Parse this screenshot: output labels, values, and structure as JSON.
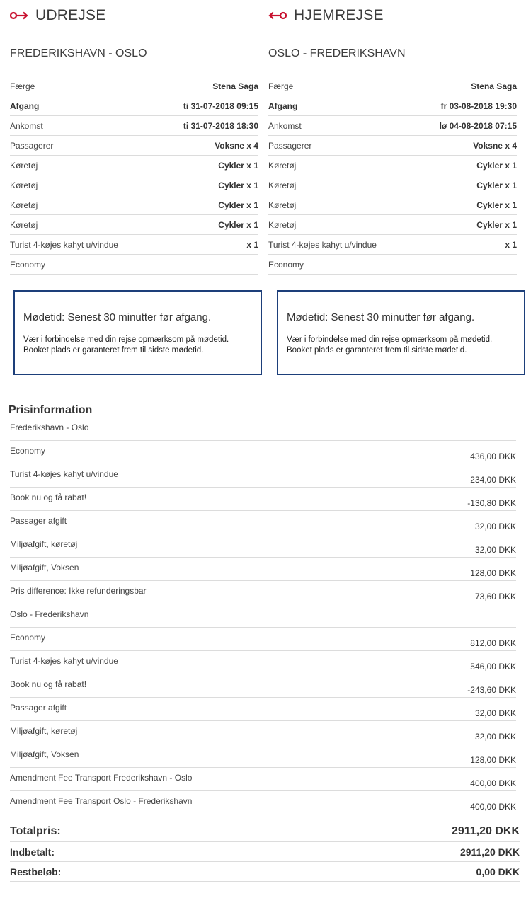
{
  "outbound": {
    "heading": "UDREJSE",
    "icon": "arrow-right-icon",
    "route": "FREDERIKSHAVN - OSLO",
    "rows": [
      {
        "label": "Færge",
        "value": "Stena Saga"
      },
      {
        "label": "Afgang",
        "value": "ti 31-07-2018 09:15"
      },
      {
        "label": "Ankomst",
        "value": "ti 31-07-2018 18:30"
      },
      {
        "label": "Passagerer",
        "value": "Voksne x 4"
      },
      {
        "label": "Køretøj",
        "value": "Cykler x 1"
      },
      {
        "label": "Køretøj",
        "value": "Cykler x 1"
      },
      {
        "label": "Køretøj",
        "value": "Cykler x 1"
      },
      {
        "label": "Køretøj",
        "value": "Cykler x 1"
      },
      {
        "label": "Turist 4-køjes kahyt u/vindue",
        "value": "x 1"
      },
      {
        "label": "Economy",
        "value": ""
      }
    ],
    "notice": {
      "title": "Mødetid: Senest 30 minutter før afgang.",
      "line1": "Vær i forbindelse med din rejse opmærksom på mødetid.",
      "line2": "Booket plads er garanteret frem til sidste mødetid."
    }
  },
  "return": {
    "heading": "HJEMREJSE",
    "icon": "arrow-left-icon",
    "route": "OSLO - FREDERIKSHAVN",
    "rows": [
      {
        "label": "Færge",
        "value": "Stena Saga"
      },
      {
        "label": "Afgang",
        "value": "fr 03-08-2018 19:30"
      },
      {
        "label": "Ankomst",
        "value": "lø 04-08-2018 07:15"
      },
      {
        "label": "Passagerer",
        "value": "Voksne x 4"
      },
      {
        "label": "Køretøj",
        "value": "Cykler x 1"
      },
      {
        "label": "Køretøj",
        "value": "Cykler x 1"
      },
      {
        "label": "Køretøj",
        "value": "Cykler x 1"
      },
      {
        "label": "Køretøj",
        "value": "Cykler x 1"
      },
      {
        "label": "Turist 4-køjes kahyt u/vindue",
        "value": "x 1"
      },
      {
        "label": "Economy",
        "value": ""
      }
    ],
    "notice": {
      "title": "Mødetid: Senest 30 minutter før afgang.",
      "line1": "Vær i forbindelse med din rejse opmærksom på mødetid.",
      "line2": "Booket plads er garanteret frem til sidste mødetid."
    }
  },
  "colors": {
    "accent_red": "#c8102e",
    "notice_border": "#1d3f7a"
  },
  "prices": {
    "heading": "Prisinformation",
    "rows": [
      {
        "label": "Frederikshavn - Oslo",
        "amount": ""
      },
      {
        "label": "Economy",
        "amount": "436,00 DKK"
      },
      {
        "label": "Turist 4-køjes kahyt u/vindue",
        "amount": "234,00 DKK"
      },
      {
        "label": "Book nu og få rabat!",
        "amount": "-130,80 DKK"
      },
      {
        "label": "Passager afgift",
        "amount": "32,00 DKK"
      },
      {
        "label": "Miljøafgift, køretøj",
        "amount": "32,00 DKK"
      },
      {
        "label": "Miljøafgift, Voksen",
        "amount": "128,00 DKK"
      },
      {
        "label": "Pris difference: Ikke refunderingsbar",
        "amount": "73,60 DKK"
      },
      {
        "label": "Oslo - Frederikshavn",
        "amount": ""
      },
      {
        "label": "Economy",
        "amount": "812,00 DKK"
      },
      {
        "label": "Turist 4-køjes kahyt u/vindue",
        "amount": "546,00 DKK"
      },
      {
        "label": "Book nu og få rabat!",
        "amount": "-243,60 DKK"
      },
      {
        "label": "Passager afgift",
        "amount": "32,00 DKK"
      },
      {
        "label": "Miljøafgift, køretøj",
        "amount": "32,00 DKK"
      },
      {
        "label": "Miljøafgift, Voksen",
        "amount": "128,00 DKK"
      },
      {
        "label": "Amendment Fee Transport Frederikshavn - Oslo",
        "amount": "400,00 DKK"
      },
      {
        "label": "Amendment Fee Transport Oslo - Frederikshavn",
        "amount": "400,00 DKK"
      }
    ]
  },
  "totals": {
    "total_label": "Totalpris:",
    "total_value": "2911,20 DKK",
    "paid_label": "Indbetalt:",
    "paid_value": "2911,20 DKK",
    "rest_label": "Restbeløb:",
    "rest_value": "0,00 DKK"
  }
}
